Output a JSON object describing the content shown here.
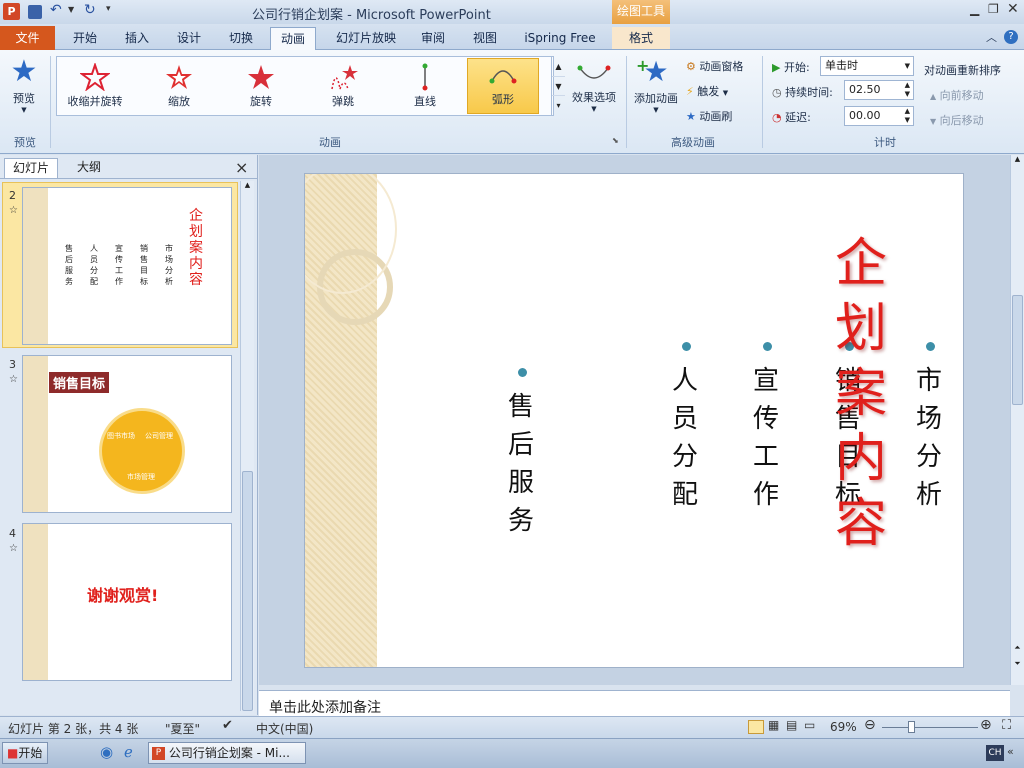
{
  "window": {
    "title": "公司行销企划案 - Microsoft PowerPoint",
    "context_tab_group": "绘图工具"
  },
  "tabs": [
    "文件",
    "开始",
    "插入",
    "设计",
    "切换",
    "动画",
    "幻灯片放映",
    "审阅",
    "视图",
    "iSpring Free",
    "格式"
  ],
  "ribbon": {
    "preview_label": "预览",
    "preview_group": "预览",
    "effects": [
      "收缩并旋转",
      "缩放",
      "旋转",
      "弹跳",
      "直线",
      "弧形"
    ],
    "effect_options": "效果选项",
    "animation_group": "动画",
    "add_animation": "添加动画",
    "animation_pane": "动画窗格",
    "trigger": "触发",
    "animation_painter": "动画刷",
    "advanced_group": "高级动画",
    "start_label": "开始:",
    "start_value": "单击时",
    "duration_label": "持续时间:",
    "duration_value": "02.50",
    "delay_label": "延迟:",
    "delay_value": "00.00",
    "timing_group": "计时",
    "reorder_title": "对动画重新排序",
    "move_earlier": "向前移动",
    "move_later": "向后移动"
  },
  "left_pane": {
    "tab_slides": "幻灯片",
    "tab_outline": "大纲",
    "close": "×",
    "slides": [
      {
        "num": "2",
        "title": "企划案内容",
        "items": [
          "市场分析",
          "销售目标",
          "宣传工作",
          "人员分配",
          "售后服务"
        ]
      },
      {
        "num": "3",
        "title": "销售目标",
        "segments": [
          "图书市场",
          "公司管理",
          "市场管理"
        ]
      },
      {
        "num": "4",
        "title": "谢谢观赏!"
      }
    ]
  },
  "slide": {
    "title": "企划案内容",
    "columns": [
      "市场分析",
      "销售目标",
      "宣传工作",
      "人员分配",
      "售后服务"
    ]
  },
  "notes_placeholder": "单击此处添加备注",
  "status": {
    "slide_info": "幻灯片 第 2 张，共 4 张",
    "theme": "\"夏至\"",
    "language": "中文(中国)",
    "zoom": "69%"
  },
  "taskbar": {
    "start": "开始",
    "task": "公司行销企划案 - Mi...",
    "ime": "CH"
  },
  "colors": {
    "accent_red": "#e0201c",
    "bullet": "#3d8fa8",
    "file_tab": "#d5571d",
    "context_tab": "#e8a040"
  }
}
